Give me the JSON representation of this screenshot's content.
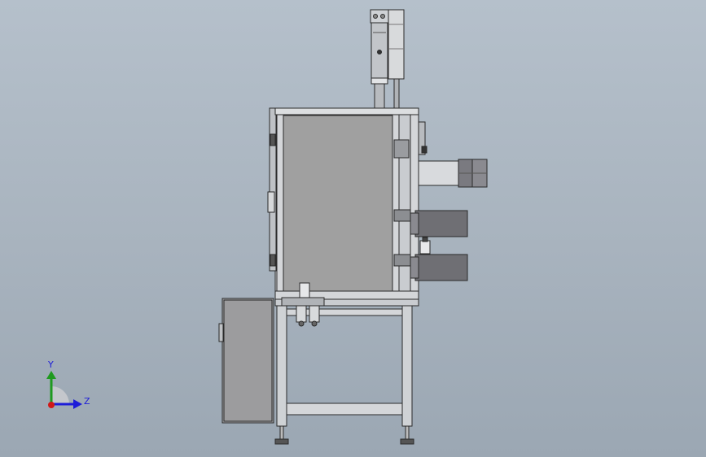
{
  "view": {
    "model": "machine-frame-side-view",
    "background": {
      "top": "#b5c0cb",
      "bottom": "#9ba7b3"
    }
  },
  "triad": {
    "y_label": "Y",
    "z_label": "Z",
    "colors": {
      "y_axis": "#1f9a1f",
      "z_axis": "#1d1dd8",
      "x_axis": "#d01818"
    }
  },
  "colors": {
    "outline": "#2a2a2a",
    "panel": "#a0a0a0",
    "frame": "#c9ccd0",
    "dark_block": "#6f6f74",
    "mid_block": "#8a8a90",
    "light_block": "#d8dadd"
  }
}
